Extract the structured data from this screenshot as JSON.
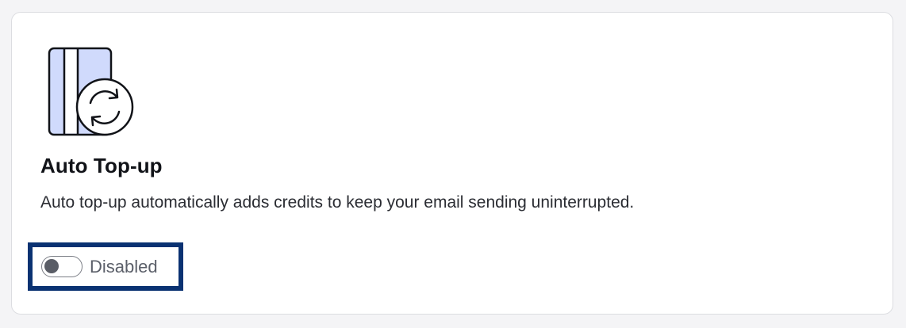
{
  "card": {
    "illustration_icon": "credit-card-refresh-icon",
    "title": "Auto Top-up",
    "description": "Auto top-up automatically adds credits to keep your email sending uninterrupted."
  },
  "toggle": {
    "state": "off",
    "label": "Disabled"
  },
  "colors": {
    "card_fill_accent": "#d0dafc",
    "highlight_border": "#0a3272",
    "knob": "#5a5d66"
  }
}
